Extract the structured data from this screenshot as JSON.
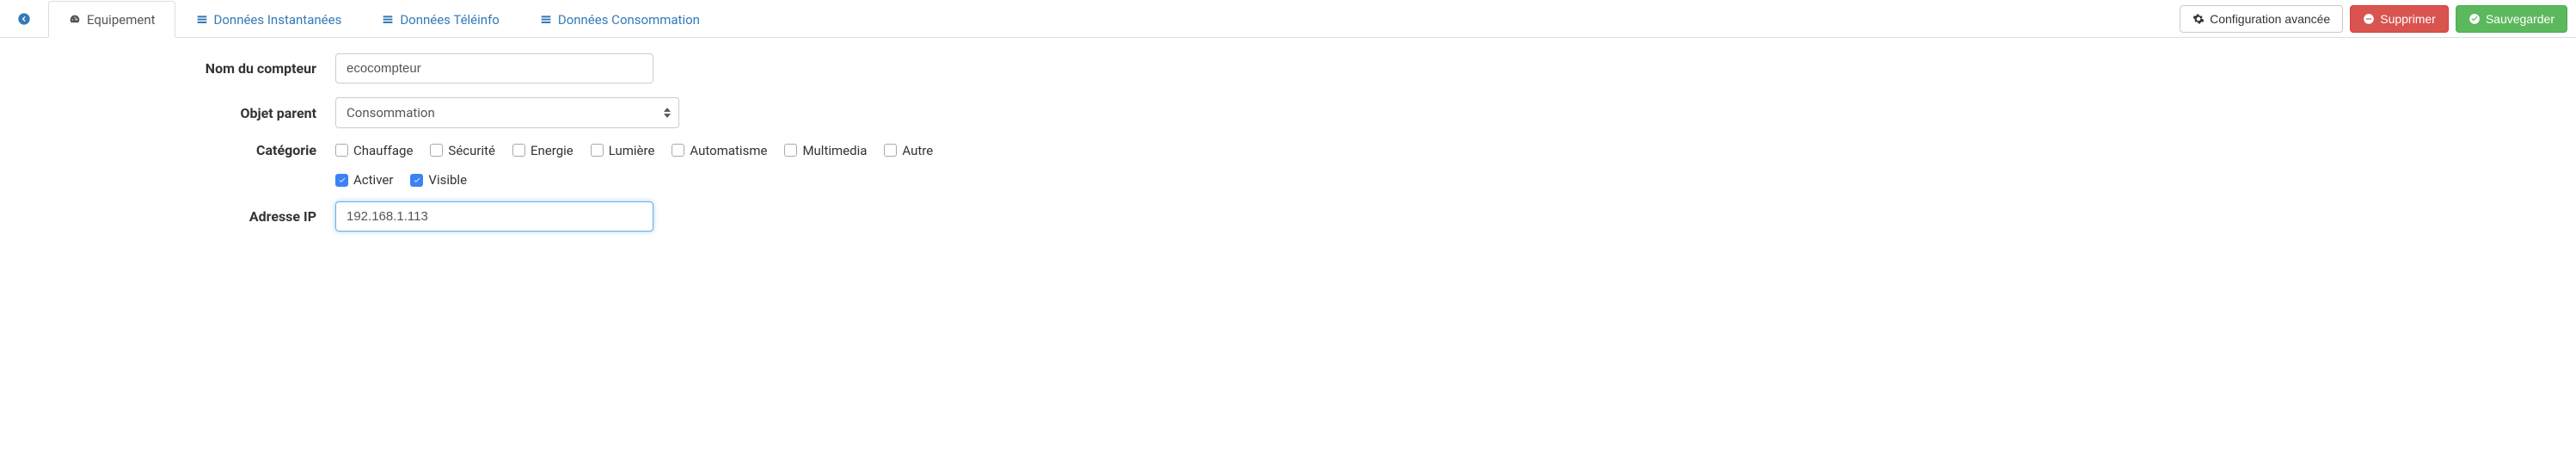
{
  "tabs": {
    "equipment": "Equipement",
    "instant": "Données Instantanées",
    "teleinfo": "Données Téléinfo",
    "consumption": "Données Consommation"
  },
  "actions": {
    "advanced_config": "Configuration avancée",
    "delete": "Supprimer",
    "save": "Sauvegarder"
  },
  "form": {
    "name_label": "Nom du compteur",
    "name_value": "ecocompteur",
    "parent_label": "Objet parent",
    "parent_value": "Consommation",
    "category_label": "Catégorie",
    "categories": {
      "heating": "Chauffage",
      "security": "Sécurité",
      "energy": "Energie",
      "light": "Lumière",
      "automation": "Automatisme",
      "multimedia": "Multimedia",
      "other": "Autre"
    },
    "activate_label": "Activer",
    "visible_label": "Visible",
    "ip_label": "Adresse IP",
    "ip_value": "192.168.1.113"
  }
}
